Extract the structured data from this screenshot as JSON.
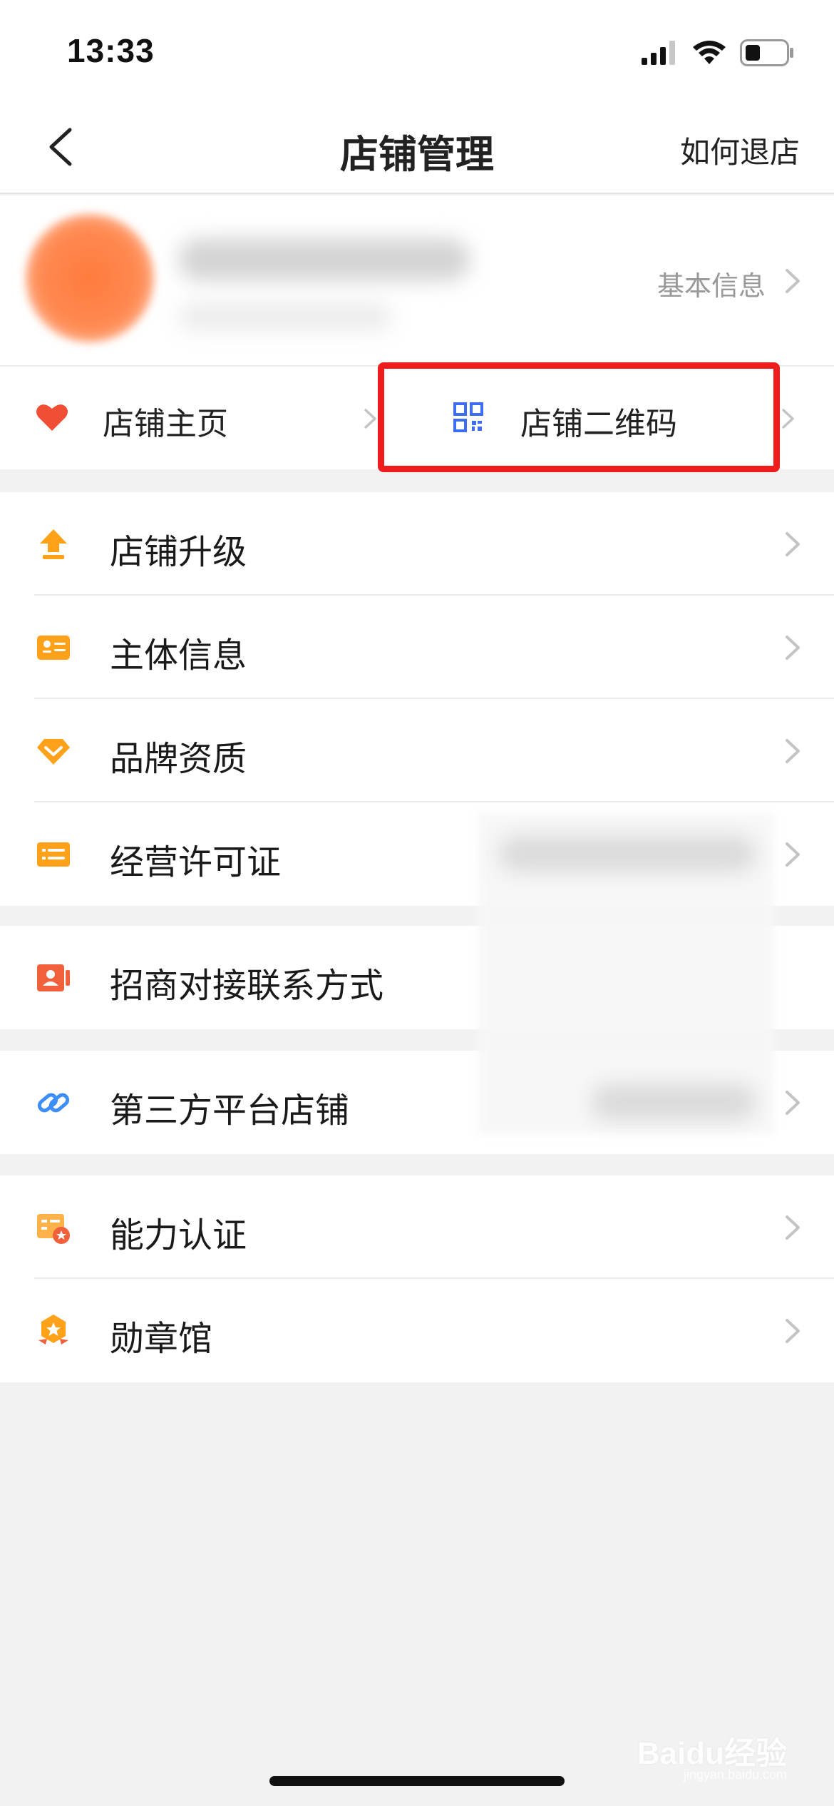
{
  "status_bar": {
    "time": "13:33"
  },
  "nav": {
    "title": "店铺管理",
    "right_action": "如何退店"
  },
  "store": {
    "basic_info_label": "基本信息"
  },
  "quick_links": {
    "home": {
      "label": "店铺主页",
      "icon": "heart-icon",
      "color": "#f04e35"
    },
    "qrcode": {
      "label": "店铺二维码",
      "icon": "qrcode-icon",
      "color": "#3d6df2"
    }
  },
  "sections": [
    {
      "items": [
        {
          "label": "店铺升级",
          "icon": "upgrade-arrow-icon"
        },
        {
          "label": "主体信息",
          "icon": "id-card-icon"
        },
        {
          "label": "品牌资质",
          "icon": "diamond-icon"
        },
        {
          "label": "经营许可证",
          "icon": "license-icon"
        }
      ]
    },
    {
      "items": [
        {
          "label": "招商对接联系方式",
          "icon": "contact-icon"
        }
      ]
    },
    {
      "items": [
        {
          "label": "第三方平台店铺",
          "icon": "link-icon"
        }
      ]
    },
    {
      "items": [
        {
          "label": "能力认证",
          "icon": "certificate-icon"
        },
        {
          "label": "勋章馆",
          "icon": "medal-icon"
        }
      ]
    }
  ],
  "watermark": {
    "brand": "Baidu经验",
    "url": "jingyan.baidu.com"
  },
  "colors": {
    "accent_orange": "#ffa21a",
    "highlight_red": "#ee1c1c",
    "link_blue": "#3d8ef7"
  }
}
